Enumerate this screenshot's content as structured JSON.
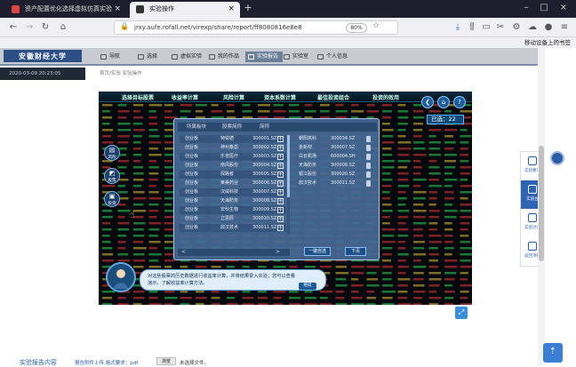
{
  "browser": {
    "tabs": [
      {
        "title": "资产配置优化选择虚拟仿真实验",
        "active": false
      },
      {
        "title": "实验操作",
        "active": true
      }
    ],
    "new_tab": "+",
    "url": "jrxy.aufe.rofall.net/virexp/share/report/ff8080816e8e8",
    "zoom": "80%",
    "bookmark_text": "移动设备上的书签"
  },
  "site": {
    "logo": "安徽财经大学",
    "menu": [
      {
        "label": "导航",
        "active": false
      },
      {
        "label": "选择",
        "active": false
      },
      {
        "label": "虚拟实验",
        "active": false
      },
      {
        "label": "我的作品",
        "active": false
      },
      {
        "label": "实验报告",
        "active": true
      },
      {
        "label": "实验室",
        "active": false
      },
      {
        "label": "个人信息",
        "active": false
      }
    ],
    "datetime": "2020-03-09  20:23:05",
    "breadcrumb": "首页/实验  实验操作"
  },
  "sim": {
    "top_menu": [
      "选择目标股票",
      "收益率计算",
      "风险计算",
      "资本系数计算",
      "最佳投资组合",
      "投资的效用"
    ],
    "counter_label": "已选",
    "counter_value": "22",
    "left_buttons": [
      "风险",
      "股票",
      "投资",
      "帮助"
    ],
    "dialog": {
      "headers": [
        "所属板块",
        "股票简称",
        "简称"
      ],
      "rows": [
        {
          "board": "创业板",
          "name": "特锐德",
          "code": "300001.SZ"
        },
        {
          "board": "创业板",
          "name": "神州泰岳",
          "code": "300002.SZ"
        },
        {
          "board": "创业板",
          "name": "乐普医疗",
          "code": "300003.SZ"
        },
        {
          "board": "创业板",
          "name": "南风股份",
          "code": "300004.SZ"
        },
        {
          "board": "创业板",
          "name": "探路者",
          "code": "300005.SZ"
        },
        {
          "board": "创业板",
          "name": "莱美药业",
          "code": "300006.SZ"
        },
        {
          "board": "创业板",
          "name": "汉威科技",
          "code": "300007.SZ"
        },
        {
          "board": "创业板",
          "name": "天海防务",
          "code": "300008.SZ"
        },
        {
          "board": "创业板",
          "name": "安科生物",
          "code": "300009.SZ"
        },
        {
          "board": "创业板",
          "name": "立思辰",
          "code": "300010.SZ"
        },
        {
          "board": "创业板",
          "name": "鼎汉技术",
          "code": "300011.SZ"
        }
      ],
      "selected": [
        {
          "name": "朝阳高科",
          "code": "300034.SZ"
        },
        {
          "name": "金新材",
          "code": "300007.SZ"
        },
        {
          "name": "白云机场",
          "code": "600004.SH"
        },
        {
          "name": "天海防务",
          "code": "300008.SZ"
        },
        {
          "name": "银江股份",
          "code": "300020.SZ"
        },
        {
          "name": "鼎汉技术",
          "code": "300011.SZ"
        }
      ],
      "nav_prev": "<",
      "nav_next": ">",
      "btn_clear": "一键自选",
      "btn_next": "下页"
    },
    "assistant": {
      "text": "对这些股票的历史数据进行收益率计算，并将结果录入实验；您可以查看演示，了解收益率计算方法。",
      "button": "继续"
    }
  },
  "sidepanel": [
    {
      "label": "实验要求",
      "active": false
    },
    {
      "label": "实验台",
      "active": true
    },
    {
      "label": "实验讨论",
      "active": false
    },
    {
      "label": "返回顶部",
      "active": false
    }
  ],
  "bottom": {
    "report_title": "实验报告内容",
    "upload_req": "报告附件上传,格式要求：pdf",
    "file_button": "浏览",
    "file_none": "未选择文件。"
  },
  "colors": {
    "accent": "#2a5da8",
    "sim_dialog": "#46698f"
  }
}
